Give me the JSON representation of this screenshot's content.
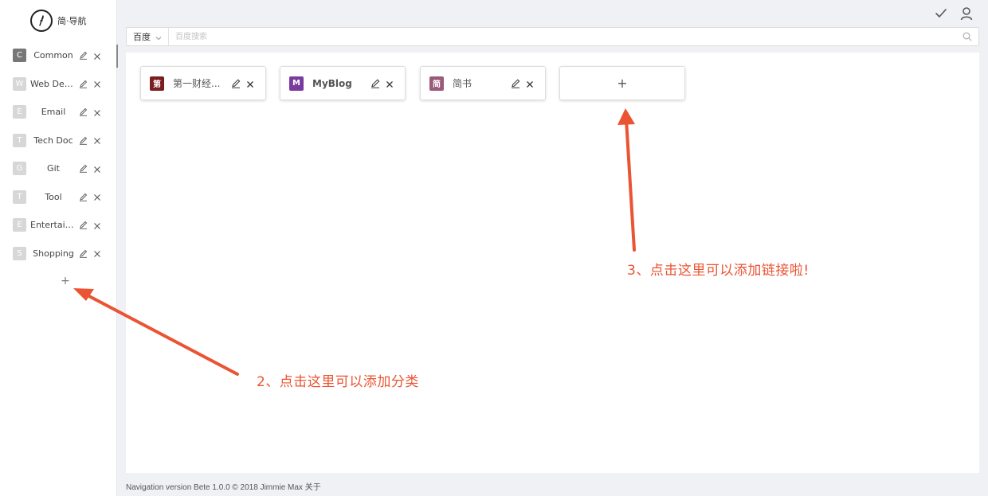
{
  "app": {
    "logo_text": "简·导航"
  },
  "sidebar": {
    "items": [
      {
        "badge": "C",
        "label": "Common",
        "active": true
      },
      {
        "badge": "W",
        "label": "Web Dev...",
        "active": false
      },
      {
        "badge": "E",
        "label": "Email",
        "active": false
      },
      {
        "badge": "T",
        "label": "Tech Doc",
        "active": false
      },
      {
        "badge": "G",
        "label": "Git",
        "active": false
      },
      {
        "badge": "T",
        "label": "Tool",
        "active": false
      },
      {
        "badge": "E",
        "label": "Entertain...",
        "active": false
      },
      {
        "badge": "S",
        "label": "Shopping",
        "active": false
      }
    ],
    "add_label": "+"
  },
  "search": {
    "engine": "百度",
    "placeholder": "百度搜索",
    "value": ""
  },
  "links": [
    {
      "badge": "第",
      "label": "第一财经...",
      "color": "#7a1f1f",
      "bold": false
    },
    {
      "badge": "M",
      "label": "MyBlog",
      "color": "#7a3aa0",
      "bold": true
    },
    {
      "badge": "简",
      "label": "简书",
      "color": "#9a5a7a",
      "bold": false
    }
  ],
  "add_link_label": "+",
  "footer": {
    "text": "Navigation version Bete 1.0.0 © 2018 Jimmie Max 关于"
  },
  "annotations": {
    "category_hint": "2、点击这里可以添加分类",
    "link_hint": "3、点击这里可以添加链接啦!"
  },
  "colors": {
    "accent": "#ea5433",
    "active_badge": "#777777",
    "inactive_badge": "#d7d7d7"
  },
  "icons": [
    "compass-icon",
    "check-icon",
    "user-icon",
    "chevron-down-icon",
    "search-icon",
    "pencil-icon",
    "close-icon",
    "plus-icon"
  ]
}
